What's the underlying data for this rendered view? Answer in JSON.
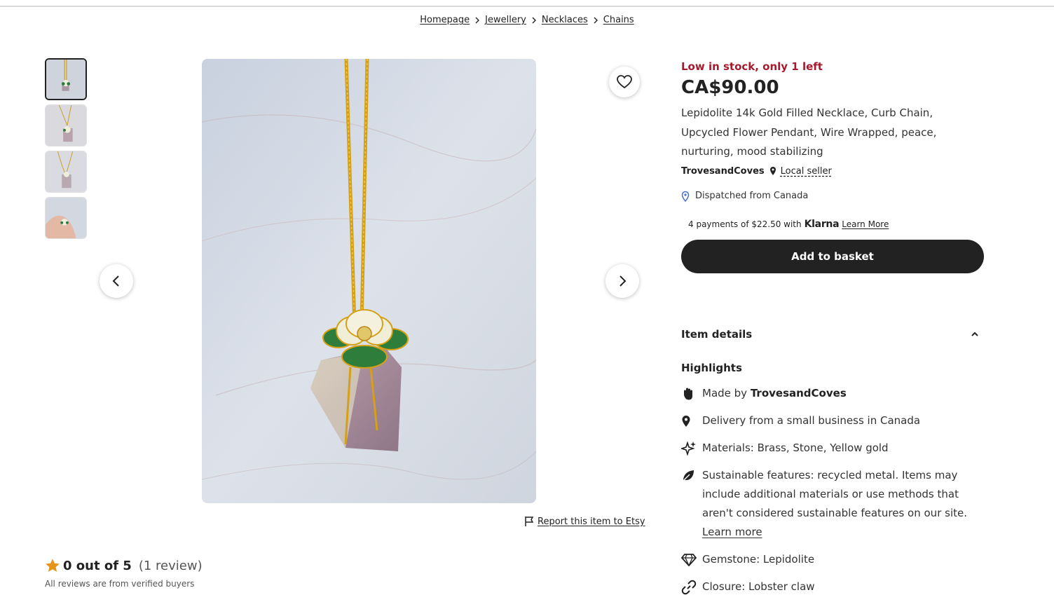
{
  "breadcrumb": [
    "Homepage",
    "Jewellery",
    "Necklaces",
    "Chains"
  ],
  "gallery": {
    "thumbnail_count": 4,
    "favorite_icon": "heart-icon",
    "prev_icon": "chevron-left-icon",
    "next_icon": "chevron-right-icon"
  },
  "report": {
    "label": "Report this item to Etsy",
    "icon": "flag-icon"
  },
  "reviews": {
    "score": "0 out of 5",
    "count": "(1 review)",
    "verified": "All reviews are from verified buyers",
    "star_color": "#e5951a"
  },
  "product": {
    "stock": "Low in stock, only 1 left",
    "price": "CA$90.00",
    "title": "Lepidolite 14k Gold Filled Necklace, Curb Chain, Upcycled Flower Pendant, Wire Wrapped, peace, nurturing, mood stabilizing",
    "shop": "TrovesandCoves",
    "local_seller": "Local seller",
    "dispatch": "Dispatched from Canada",
    "stock_color": "#a61a2e"
  },
  "klarna": {
    "text": "4 payments of $22.50 with",
    "brand": "Klarna",
    "learn": "Learn More"
  },
  "actions": {
    "add_to_basket": "Add to basket"
  },
  "details": {
    "heading": "Item details",
    "highlights": "Highlights",
    "made_by_prefix": "Made by",
    "made_by_shop": "TrovesandCoves",
    "delivery": "Delivery from a small business in Canada",
    "materials": "Materials: Brass, Stone, Yellow gold",
    "sustainable": "Sustainable features: recycled metal. Items may include additional materials or use methods that aren't considered sustainable features on our site.",
    "sustainable_learn": "Learn more",
    "gemstone": "Gemstone: Lepidolite",
    "closure": "Closure: Lobster claw"
  }
}
